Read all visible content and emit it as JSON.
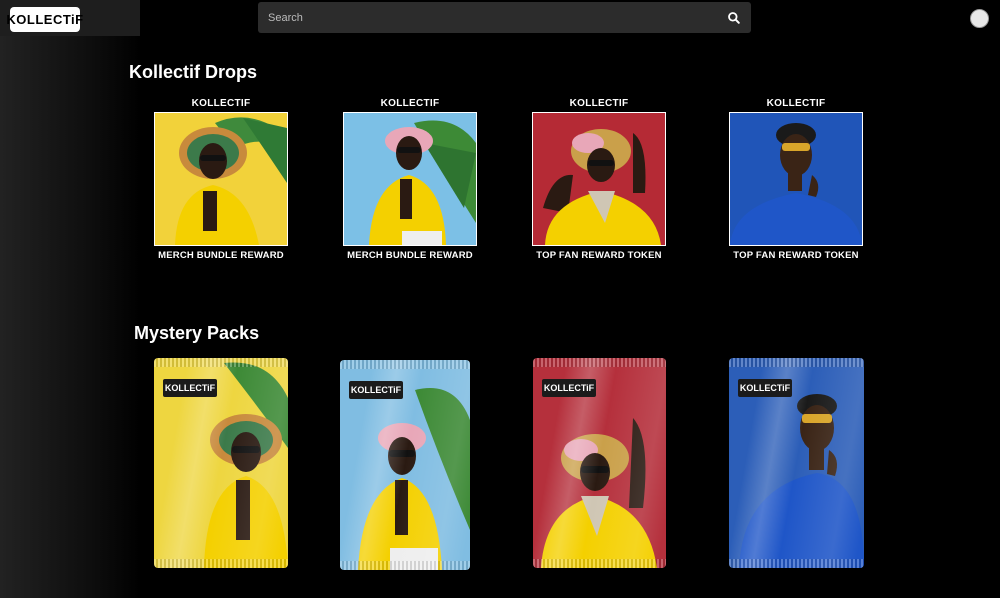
{
  "header": {
    "logo_text": "KOLLECTiF",
    "search_placeholder": "Search"
  },
  "drops": {
    "title": "Kollectif Drops",
    "items": [
      {
        "brand": "KOLLECTIF",
        "name": "MERCH BUNDLE REWARD",
        "bg": "#f2d23a"
      },
      {
        "brand": "KOLLECTIF",
        "name": "MERCH BUNDLE REWARD",
        "bg": "#7cc0e6"
      },
      {
        "brand": "KOLLECTIF",
        "name": "TOP FAN REWARD TOKEN",
        "bg": "#b52a35"
      },
      {
        "brand": "KOLLECTIF",
        "name": "TOP FAN REWARD TOKEN",
        "bg": "#2055b8"
      }
    ]
  },
  "packs": {
    "title": "Mystery Packs",
    "items": [
      {
        "logo_text": "KOLLECTiF",
        "bg": "#eed640"
      },
      {
        "logo_text": "KOLLECTiF",
        "bg": "#80bde2"
      },
      {
        "logo_text": "KOLLECTiF",
        "bg": "#b5303c"
      },
      {
        "logo_text": "KOLLECTiF",
        "bg": "#2c5eb8"
      }
    ]
  }
}
